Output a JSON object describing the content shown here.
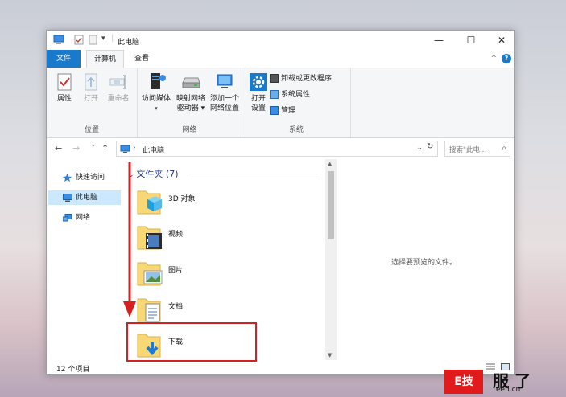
{
  "window": {
    "title": "此电脑",
    "minimize_glyph": "—",
    "maximize_glyph": "☐",
    "close_glyph": "✕",
    "qat_dropdown_glyph": "▾"
  },
  "ribbon_tabs": {
    "file": "文件",
    "computer": "计算机",
    "view": "查看"
  },
  "ribbon": {
    "location_group": {
      "label": "位置",
      "properties": "属性",
      "open": "打开",
      "rename": "重命名"
    },
    "network_group": {
      "label": "网络",
      "access_media": "访问媒体",
      "map_drive_line1": "映射网络",
      "map_drive_line2": "驱动器 ▾",
      "add_location_line1": "添加一个",
      "add_location_line2": "网络位置"
    },
    "system_group": {
      "label": "系统",
      "open_settings_line1": "打开",
      "open_settings_line2": "设置",
      "uninstall": "卸载或更改程序",
      "system_properties": "系统属性",
      "manage": "管理"
    },
    "collapse_glyph": "^",
    "help_glyph": "?"
  },
  "address_bar": {
    "back_glyph": "←",
    "forward_glyph": "→",
    "recent_glyph": "⌄",
    "up_glyph": "↑",
    "separator": "›",
    "path": "此电脑",
    "dropdown_glyph": "⌄",
    "refresh_glyph": "↻",
    "search_placeholder": "搜索\"此电...",
    "search_glyph": "⌕"
  },
  "nav_pane": {
    "items": [
      {
        "label": "快速访问",
        "icon": "star-pin-icon"
      },
      {
        "label": "此电脑",
        "icon": "monitor-icon",
        "selected": true
      },
      {
        "label": "网络",
        "icon": "network-icon"
      }
    ]
  },
  "content": {
    "group_header": "文件夹 (7)",
    "folders": [
      {
        "name": "3D 对象",
        "icon": "3d-objects-folder-icon"
      },
      {
        "name": "视频",
        "icon": "videos-folder-icon"
      },
      {
        "name": "图片",
        "icon": "pictures-folder-icon"
      },
      {
        "name": "文档",
        "icon": "documents-folder-icon"
      },
      {
        "name": "下载",
        "icon": "downloads-folder-icon"
      }
    ]
  },
  "preview_pane": {
    "message": "选择要预览的文件。"
  },
  "status_bar": {
    "item_count": "12 个项目"
  },
  "watermark": {
    "badge": "E技",
    "big": "服 了",
    "url": "eefl.cn"
  },
  "colors": {
    "accent": "#1979ca",
    "selection": "#cce8ff",
    "highlight_red": "#d81f1f",
    "folder_yellow": "#f8d775",
    "group_header_blue": "#1e3287"
  }
}
